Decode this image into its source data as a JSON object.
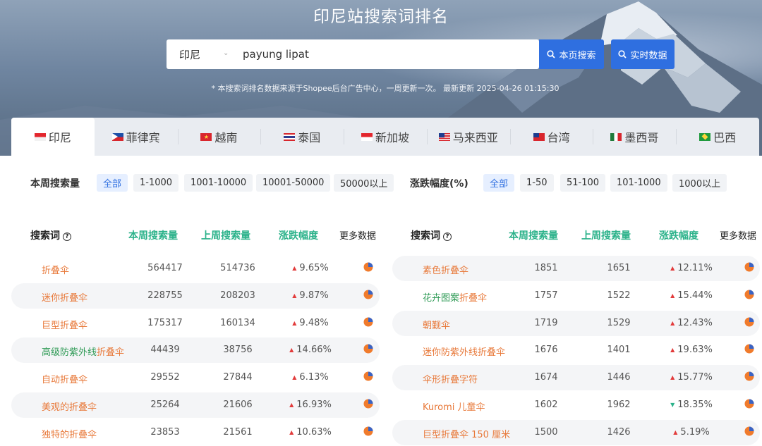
{
  "page_title": "印尼站搜索词排名",
  "search": {
    "region": "印尼",
    "query": "payung lipat",
    "btn_page": "本页搜索",
    "btn_live": "实时数据"
  },
  "notice": "* 本搜索词排名数据来源于Shopee后台广告中心，一周更新一次。 最新更新 2025-04-26 01:15:30",
  "tabs": [
    {
      "label": "印尼",
      "flag": "indonesia-flag-icon"
    },
    {
      "label": "菲律宾",
      "flag": "philippines-flag-icon"
    },
    {
      "label": "越南",
      "flag": "vietnam-flag-icon"
    },
    {
      "label": "泰国",
      "flag": "thailand-flag-icon"
    },
    {
      "label": "新加坡",
      "flag": "singapore-flag-icon"
    },
    {
      "label": "马来西亚",
      "flag": "malaysia-flag-icon"
    },
    {
      "label": "台湾",
      "flag": "taiwan-flag-icon"
    },
    {
      "label": "墨西哥",
      "flag": "mexico-flag-icon"
    },
    {
      "label": "巴西",
      "flag": "brazil-flag-icon"
    }
  ],
  "filters": {
    "volume_label": "本周搜索量",
    "volume_options": [
      "全部",
      "1-1000",
      "1001-10000",
      "10001-50000",
      "50000以上"
    ],
    "change_label": "涨跌幅度(%)",
    "change_options": [
      "全部",
      "1-50",
      "51-100",
      "101-1000",
      "1000以上"
    ]
  },
  "columns": {
    "keyword": "搜索词",
    "this_week": "本周搜索量",
    "last_week": "上周搜索量",
    "change": "涨跌幅度",
    "more": "更多数据"
  },
  "left_rows": [
    {
      "kw": "折叠伞",
      "tw": "564417",
      "lw": "514736",
      "chg": "9.65%",
      "dir": "up"
    },
    {
      "kw": "迷你折叠伞",
      "tw": "228755",
      "lw": "208203",
      "chg": "9.87%",
      "dir": "up"
    },
    {
      "kw": "巨型折叠伞",
      "tw": "175317",
      "lw": "160134",
      "chg": "9.48%",
      "dir": "up"
    },
    {
      "kw_pre": "高级防紫外线",
      "kw": "折叠伞",
      "tw": "44439",
      "lw": "38756",
      "chg": "14.66%",
      "dir": "up"
    },
    {
      "kw": "自动折叠伞",
      "tw": "29552",
      "lw": "27844",
      "chg": "6.13%",
      "dir": "up"
    },
    {
      "kw": "美观的折叠伞",
      "tw": "25264",
      "lw": "21606",
      "chg": "16.93%",
      "dir": "up"
    },
    {
      "kw": "独特的折叠伞",
      "tw": "23853",
      "lw": "21561",
      "chg": "10.63%",
      "dir": "up"
    }
  ],
  "right_rows": [
    {
      "kw": "素色折叠伞",
      "tw": "1851",
      "lw": "1651",
      "chg": "12.11%",
      "dir": "up"
    },
    {
      "kw_pre": "花卉图案",
      "kw": "折叠伞",
      "tw": "1757",
      "lw": "1522",
      "chg": "15.44%",
      "dir": "up"
    },
    {
      "kw": "朝觐伞",
      "tw": "1719",
      "lw": "1529",
      "chg": "12.43%",
      "dir": "up"
    },
    {
      "kw": "迷你防紫外线折叠伞",
      "tw": "1676",
      "lw": "1401",
      "chg": "19.63%",
      "dir": "up"
    },
    {
      "kw": "伞形折叠字符",
      "tw": "1674",
      "lw": "1446",
      "chg": "15.77%",
      "dir": "up"
    },
    {
      "kw": "Kuromi 儿童伞",
      "tw": "1602",
      "lw": "1962",
      "chg": "18.35%",
      "dir": "down"
    },
    {
      "kw": "巨型折叠伞 150 厘米",
      "tw": "1500",
      "lw": "1426",
      "chg": "5.19%",
      "dir": "up"
    }
  ],
  "up_arrow": "▲",
  "down_arrow": "▼",
  "colors": {
    "accent_blue": "#2f6fe0",
    "keyword_orange": "#e8793a",
    "header_green": "#2bb28a",
    "up_red": "#e23b3b"
  }
}
